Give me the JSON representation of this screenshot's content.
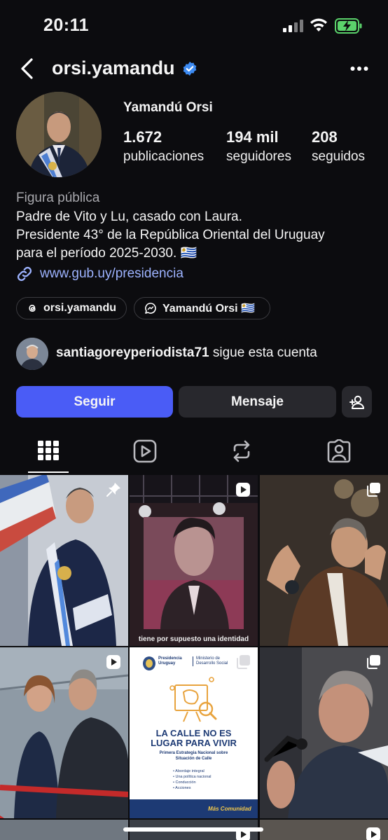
{
  "status_bar": {
    "time": "20:11"
  },
  "header": {
    "username": "orsi.yamandu"
  },
  "profile": {
    "full_name": "Yamandú Orsi",
    "stats": [
      {
        "value": "1.672",
        "label": "publicaciones"
      },
      {
        "value": "194 mil",
        "label": "seguidores"
      },
      {
        "value": "208",
        "label": "seguidos"
      }
    ],
    "category": "Figura pública",
    "bio_lines": [
      "Padre de Vito y Lu, casado con Laura.",
      "Presidente 43° de la República Oriental del Uruguay",
      "para el período 2025-2030. 🇺🇾"
    ],
    "link": "www.gub.uy/presidencia",
    "chips": [
      {
        "label": "orsi.yamandu"
      },
      {
        "label": "Yamandú Orsi  🇺🇾"
      }
    ]
  },
  "followed_by": {
    "username": "santiagoreyperiodista71",
    "suffix": " sigue esta cuenta"
  },
  "actions": {
    "follow": "Seguir",
    "message": "Mensaje"
  },
  "tabs": [
    "grid-icon",
    "reels-icon",
    "repost-icon",
    "tagged-icon"
  ],
  "grid": {
    "tile2_caption": "tiene por supuesto una identidad",
    "tile5": {
      "org1": "Presidencia Uruguay",
      "org2": "Ministerio de Desarrollo Social",
      "headline1": "LA CALLE NO ES",
      "headline2": "LUGAR PARA VIVIR",
      "sub1": "Primera Estrategia Nacional sobre",
      "sub2": "Situación de Calle",
      "bullets": [
        "Abordaje integral",
        "Una política nacional",
        "Conducción",
        "Acciones"
      ],
      "footer": "Más Comunidad"
    }
  },
  "colors": {
    "accent": "#4a5cf6",
    "link": "#9db3ff",
    "verified": "#3d8bf2"
  }
}
